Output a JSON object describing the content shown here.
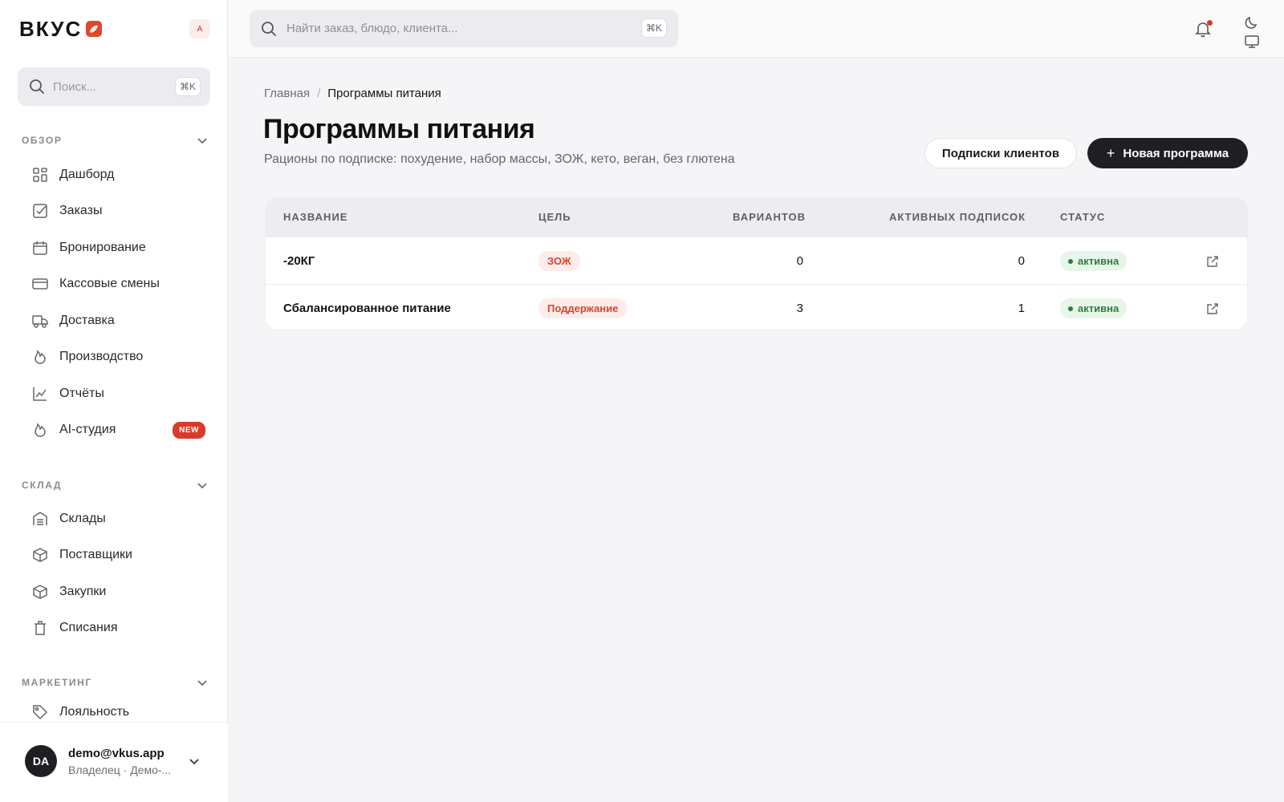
{
  "brand": {
    "name": "ВКУС",
    "accent": "#e0482d"
  },
  "workspace_badge": "A",
  "sidebar": {
    "search": {
      "placeholder": "Поиск...",
      "shortcut": "⌘K"
    },
    "sections": [
      {
        "title": "ОБЗОР",
        "items": [
          {
            "label": "Дашборд",
            "icon": "dashboard-icon"
          },
          {
            "label": "Заказы",
            "icon": "checkbox-icon"
          },
          {
            "label": "Бронирование",
            "icon": "calendar-icon"
          },
          {
            "label": "Кассовые смены",
            "icon": "credit-card-icon"
          },
          {
            "label": "Доставка",
            "icon": "truck-icon"
          },
          {
            "label": "Производство",
            "icon": "flame-icon"
          },
          {
            "label": "Отчёты",
            "icon": "chart-icon"
          },
          {
            "label": "AI-студия",
            "icon": "flame-icon",
            "badge": "NEW"
          }
        ]
      },
      {
        "title": "СКЛАД",
        "items": [
          {
            "label": "Склады",
            "icon": "warehouse-icon"
          },
          {
            "label": "Поставщики",
            "icon": "box-icon"
          },
          {
            "label": "Закупки",
            "icon": "box-icon"
          },
          {
            "label": "Списания",
            "icon": "trash-icon"
          }
        ]
      },
      {
        "title": "МАРКЕТИНГ",
        "items": [
          {
            "label": "Лояльность",
            "icon": "tag-icon"
          }
        ]
      }
    ],
    "user": {
      "initials": "DA",
      "email": "demo@vkus.app",
      "role": "Владелец · Демо-..."
    }
  },
  "topbar": {
    "search": {
      "placeholder": "Найти заказ, блюдо, клиента...",
      "shortcut": "⌘K"
    }
  },
  "breadcrumb": {
    "home": "Главная",
    "separator": "/",
    "current": "Программы питания"
  },
  "page": {
    "title": "Программы питания",
    "subtitle": "Рационы по подписке: похудение, набор массы, ЗОЖ, кето, веган, без глютена",
    "secondary_button": "Подписки клиентов",
    "primary_button": "Новая программа"
  },
  "table": {
    "columns": [
      "НАЗВАНИЕ",
      "ЦЕЛЬ",
      "ВАРИАНТОВ",
      "АКТИВНЫХ ПОДПИСОК",
      "СТАТУС"
    ],
    "rows": [
      {
        "name": "-20КГ",
        "goal": "ЗОЖ",
        "variants": "0",
        "active_subscriptions": "0",
        "status": "активна"
      },
      {
        "name": "Сбалансированное питание",
        "goal": "Поддержание",
        "variants": "3",
        "active_subscriptions": "1",
        "status": "активна"
      }
    ]
  }
}
